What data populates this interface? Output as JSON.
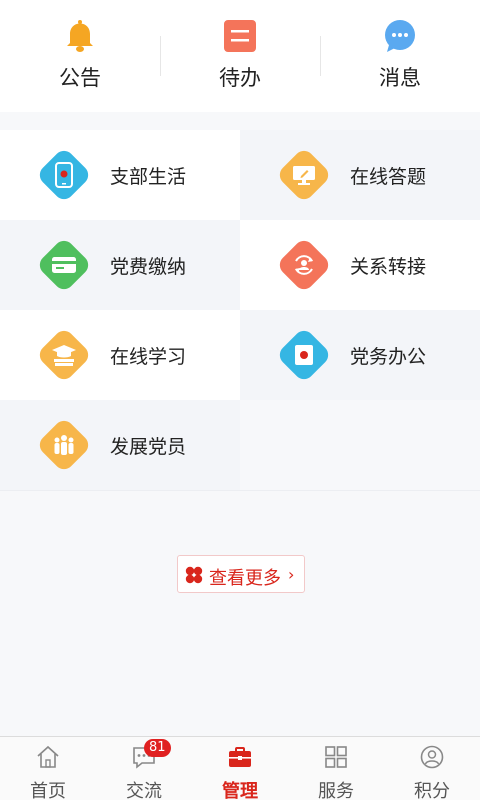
{
  "quickbar": {
    "items": [
      {
        "label": "公告",
        "icon": "bell-icon",
        "color": "#f5a623"
      },
      {
        "label": "待办",
        "icon": "todo-list-icon",
        "color": "#f4745a"
      },
      {
        "label": "消息",
        "icon": "chat-bubble-icon",
        "color": "#5aa9f0"
      }
    ]
  },
  "grid": {
    "items": [
      {
        "label": "支部生活",
        "icon": "mobile-party-icon",
        "color": "#35b6e3"
      },
      {
        "label": "在线答题",
        "icon": "monitor-pen-icon",
        "color": "#f7b64a"
      },
      {
        "label": "党费缴纳",
        "icon": "card-payment-icon",
        "color": "#4fbf5e"
      },
      {
        "label": "关系转接",
        "icon": "user-transfer-icon",
        "color": "#f4745a"
      },
      {
        "label": "在线学习",
        "icon": "graduation-books-icon",
        "color": "#f7b64a"
      },
      {
        "label": "党务办公",
        "icon": "party-document-icon",
        "color": "#35b6e3"
      },
      {
        "label": "发展党员",
        "icon": "people-group-icon",
        "color": "#f7b64a"
      }
    ]
  },
  "more": {
    "label": "查看更多",
    "chevron": "›"
  },
  "bottomnav": {
    "tabs": [
      {
        "label": "首页",
        "icon": "home-icon"
      },
      {
        "label": "交流",
        "icon": "chat-dots-icon",
        "badge": "81"
      },
      {
        "label": "管理",
        "icon": "briefcase-icon",
        "active": true
      },
      {
        "label": "服务",
        "icon": "grid-squares-icon"
      },
      {
        "label": "积分",
        "icon": "user-circle-icon"
      }
    ]
  },
  "colors": {
    "accent": "#d9261c",
    "badge": "#e02020"
  }
}
